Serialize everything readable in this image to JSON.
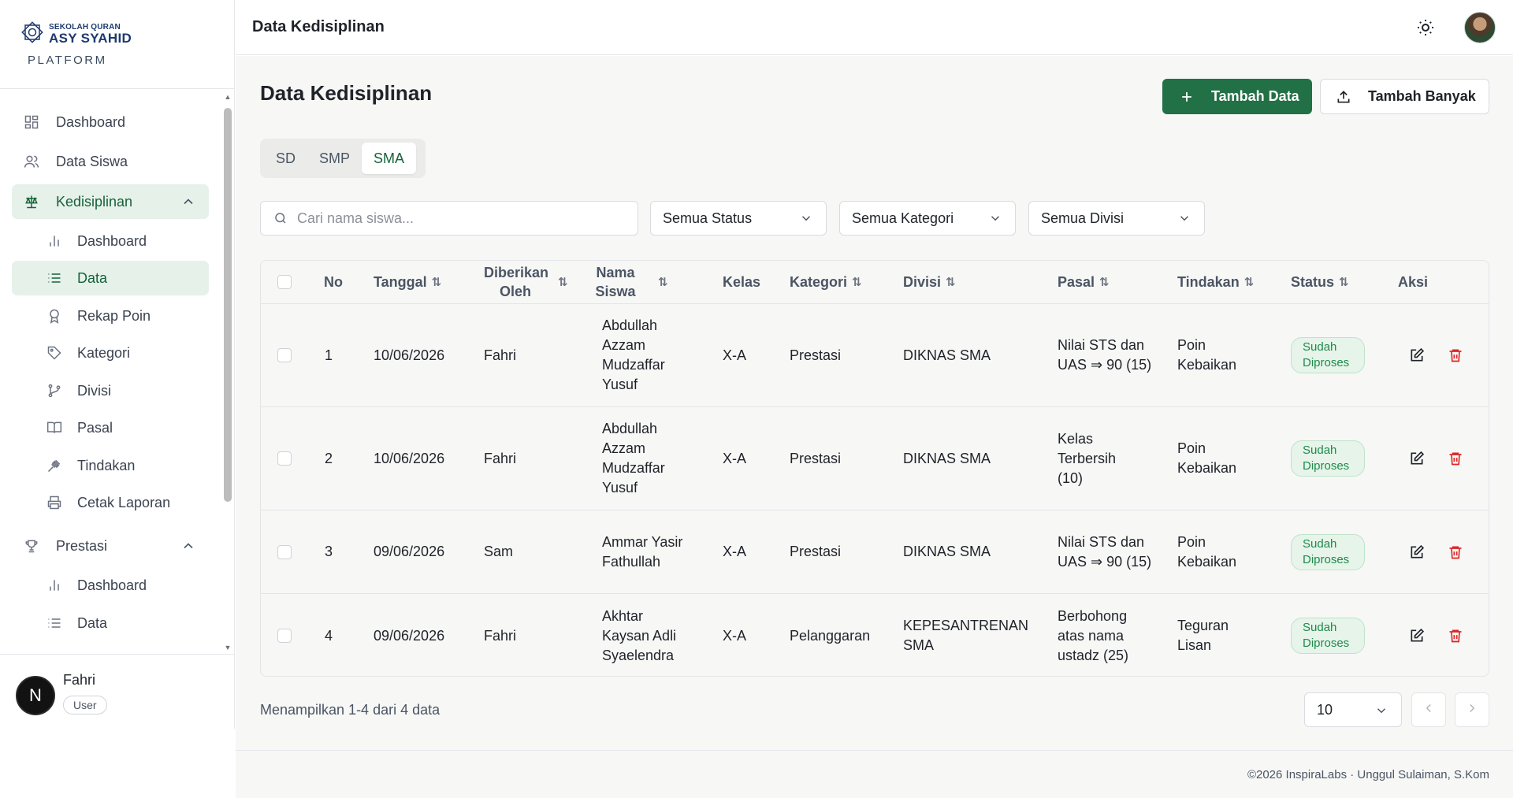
{
  "brand": {
    "line1": "SEKOLAH QURAN",
    "line2": "ASY SYAHID",
    "sub": "PLATFORM"
  },
  "sidebar": {
    "items": [
      {
        "label": "Dashboard",
        "icon": "layout-dashboard-icon"
      },
      {
        "label": "Data Siswa",
        "icon": "users-icon"
      },
      {
        "label": "Kedisiplinan",
        "icon": "scale-icon",
        "expanded": true
      },
      {
        "label": "Dashboard",
        "icon": "bar-chart-icon"
      },
      {
        "label": "Data",
        "icon": "list-icon",
        "active": true
      },
      {
        "label": "Rekap Poin",
        "icon": "award-icon"
      },
      {
        "label": "Kategori",
        "icon": "tag-icon"
      },
      {
        "label": "Divisi",
        "icon": "git-branch-icon"
      },
      {
        "label": "Pasal",
        "icon": "book-open-icon"
      },
      {
        "label": "Tindakan",
        "icon": "gavel-icon"
      },
      {
        "label": "Cetak Laporan",
        "icon": "printer-icon"
      },
      {
        "label": "Prestasi",
        "icon": "trophy-icon",
        "expanded": true
      },
      {
        "label": "Dashboard",
        "icon": "bar-chart-icon"
      },
      {
        "label": "Data",
        "icon": "list-icon"
      }
    ]
  },
  "user": {
    "initial": "N",
    "name": "Fahri",
    "role": "User"
  },
  "header": {
    "title": "Data Kedisiplinan"
  },
  "page": {
    "title": "Data Kedisiplinan",
    "add_label": "Tambah Data",
    "bulk_label": "Tambah Banyak",
    "tabs": [
      "SD",
      "SMP",
      "SMA"
    ],
    "active_tab": "SMA"
  },
  "filters": {
    "search_placeholder": "Cari nama siswa...",
    "status": "Semua Status",
    "kategori": "Semua Kategori",
    "divisi": "Semua Divisi"
  },
  "table": {
    "headers": {
      "no": "No",
      "tanggal": "Tanggal",
      "diberikan_oleh": "Diberikan Oleh",
      "nama_siswa": "Nama Siswa",
      "kelas": "Kelas",
      "kategori": "Kategori",
      "divisi": "Divisi",
      "pasal": "Pasal",
      "tindakan": "Tindakan",
      "status": "Status",
      "aksi": "Aksi"
    },
    "rows": [
      {
        "no": "1",
        "tanggal": "10/06/2026",
        "oleh": "Fahri",
        "nama": "Abdullah Azzam Mudzaffar Yusuf",
        "kelas": "X-A",
        "kategori": "Prestasi",
        "divisi": "DIKNAS SMA",
        "pasal": "Nilai STS dan UAS ⇒ 90 (15)",
        "tindakan": "Poin Kebaikan",
        "status": "Sudah Diproses"
      },
      {
        "no": "2",
        "tanggal": "10/06/2026",
        "oleh": "Fahri",
        "nama": "Abdullah Azzam Mudzaffar Yusuf",
        "kelas": "X-A",
        "kategori": "Prestasi",
        "divisi": "DIKNAS SMA",
        "pasal": "Kelas Terbersih (10)",
        "tindakan": "Poin Kebaikan",
        "status": "Sudah Diproses"
      },
      {
        "no": "3",
        "tanggal": "09/06/2026",
        "oleh": "Sam",
        "nama": "Ammar Yasir Fathullah",
        "kelas": "X-A",
        "kategori": "Prestasi",
        "divisi": "DIKNAS SMA",
        "pasal": "Nilai STS dan UAS ⇒ 90 (15)",
        "tindakan": "Poin Kebaikan",
        "status": "Sudah Diproses"
      },
      {
        "no": "4",
        "tanggal": "09/06/2026",
        "oleh": "Fahri",
        "nama": "Akhtar Kaysan Adli Syaelendra",
        "kelas": "X-A",
        "kategori": "Pelanggaran",
        "divisi": "KEPESANTRENAN SMA",
        "pasal": "Berbohong atas nama ustadz (25)",
        "tindakan": "Teguran Lisan",
        "status": "Sudah Diproses"
      }
    ]
  },
  "pagination": {
    "info": "Menampilkan 1-4 dari 4 data",
    "per_page": "10"
  },
  "footer": {
    "text": "©2026 InspiraLabs · Unggul Sulaiman, S.Kom"
  },
  "colors": {
    "primary": "#227045",
    "active_bg": "#e6f1ea",
    "badge_text": "#1e8a4b",
    "danger": "#dc2626"
  }
}
